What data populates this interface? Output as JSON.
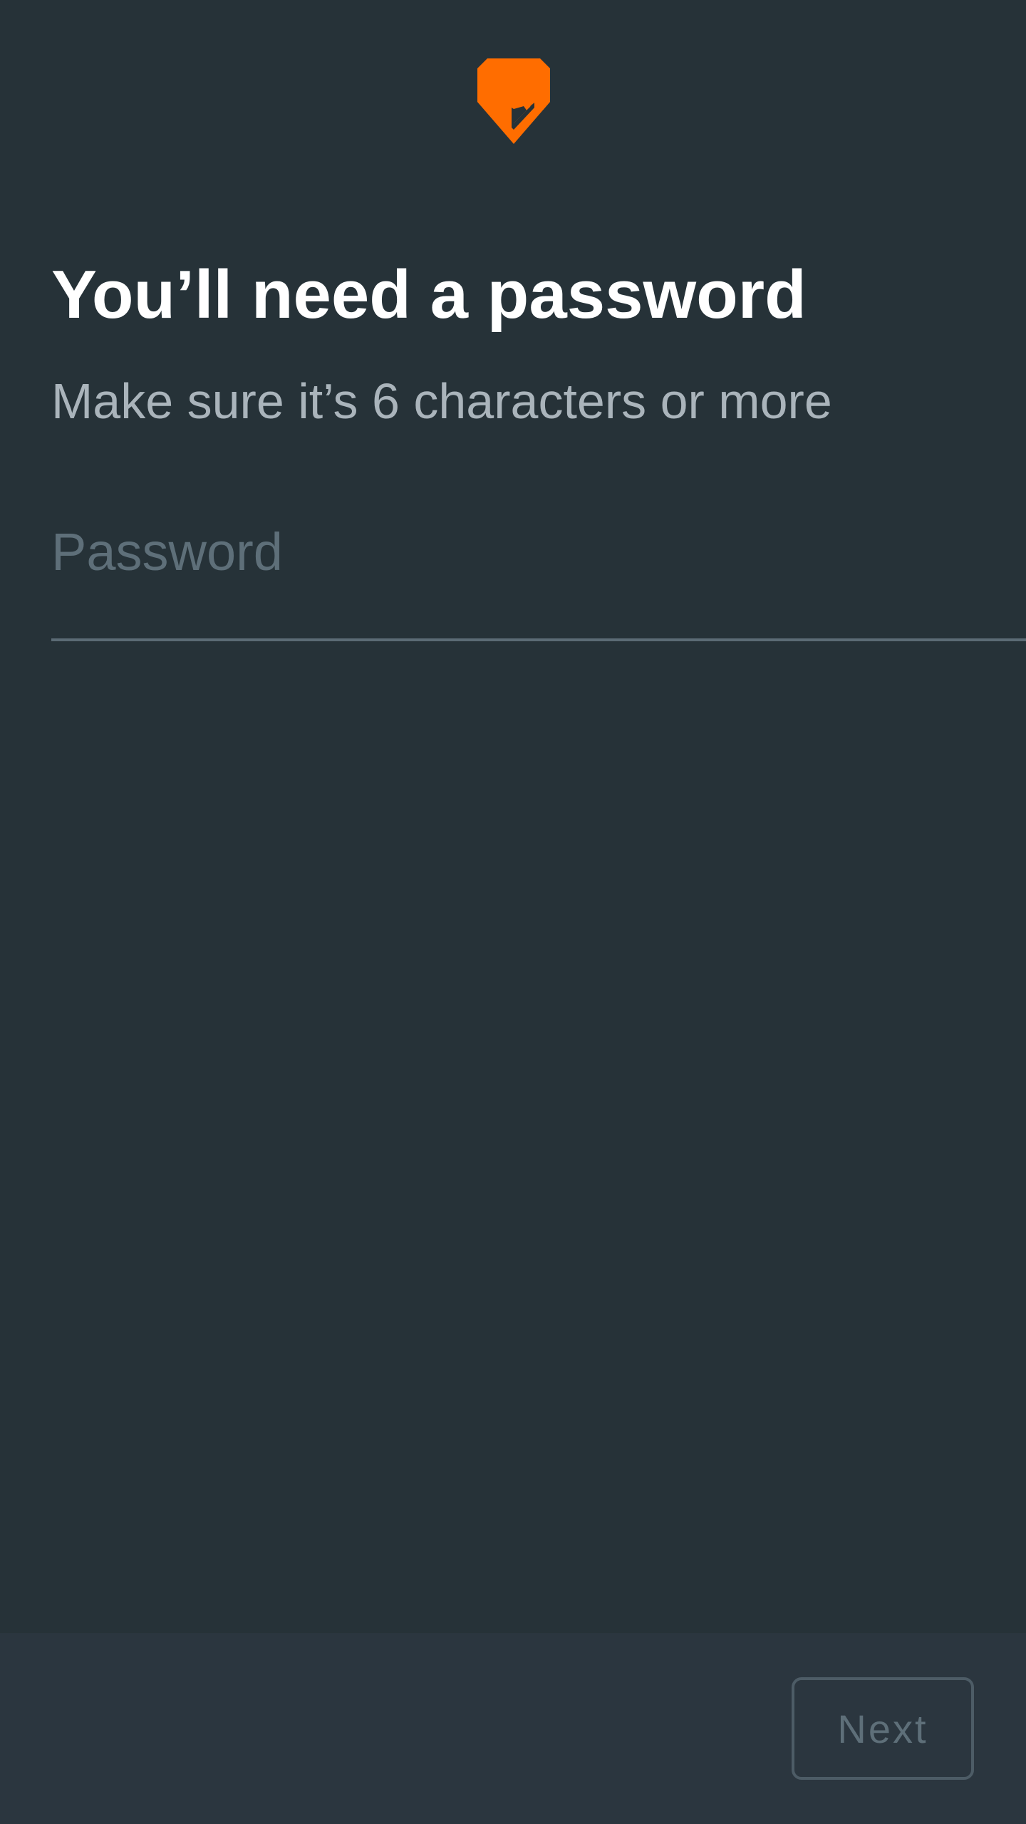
{
  "header": {
    "logo_icon": "brand-shield-check-icon",
    "logo_color": "#FF6D00"
  },
  "main": {
    "title": "You’ll need a password",
    "subtitle": "Make sure it’s 6 characters or more",
    "password_field": {
      "value": "",
      "placeholder": "Password"
    }
  },
  "footer": {
    "next_label": "Next"
  },
  "colors": {
    "background": "#263238",
    "footer_background": "#2B363F",
    "accent": "#FF6D00"
  }
}
